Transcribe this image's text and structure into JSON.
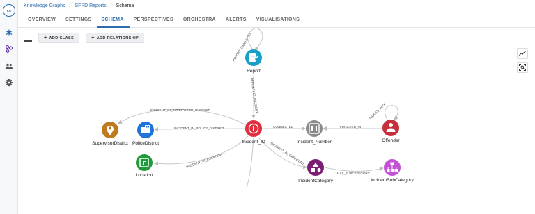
{
  "breadcrumb": {
    "items": [
      "Knowledge Graphs",
      "SFPD Reports",
      "Schema"
    ]
  },
  "tabs": [
    "OVERVIEW",
    "SETTINGS",
    "SCHEMA",
    "PERSPECTIVES",
    "ORCHESTRA",
    "ALERTS",
    "VISUALISATIONS"
  ],
  "active_tab": "SCHEMA",
  "toolbar": {
    "add_class_label": "ADD CLASS",
    "add_relationship_label": "ADD RELATIONSHIP"
  },
  "graph": {
    "nodes": {
      "report": {
        "label": "Report",
        "color": "#1aa0c8"
      },
      "incident_id": {
        "label": "Incident_ID",
        "color": "#e0303f"
      },
      "incident_number": {
        "label": "Incident_Number",
        "color": "#8b8b8b"
      },
      "offender": {
        "label": "Offender",
        "color": "#c62f3c"
      },
      "supervisor_district": {
        "label": "SupervisorDistrict",
        "color": "#c07a1e"
      },
      "police_district": {
        "label": "PoliceDistrict",
        "color": "#1f74d8"
      },
      "location": {
        "label": "Location",
        "color": "#1f9a3a"
      },
      "incident_category": {
        "label": "IncidentCategory",
        "color": "#7c1f72"
      },
      "incident_sub_category": {
        "label": "IncidentSubCategory",
        "color": "#c452d6"
      }
    },
    "edges": {
      "report_linked_to": "REPORT_LINKED_TO",
      "reporting_incident": "REPORTING_INCIDENT",
      "in_supervisor_district": "INCIDENT_IN_SUPERVISOR_DISTRICT",
      "in_police_district": "INCIDENT_IN_POLICE_DISTRICT",
      "connected": "CONNECTED",
      "involved_in": "INVOLVED_IN",
      "works_with": "WORKS_WITH",
      "in_location": "INCIDENT_IN_LOCATION",
      "in_category": "INCIDENT_IN_CATEGORY",
      "has_subcategory": "HAS_SUBCATEGORY"
    }
  },
  "colors": {
    "accent": "#2b6cb0",
    "edge": "#c4c7cc"
  }
}
